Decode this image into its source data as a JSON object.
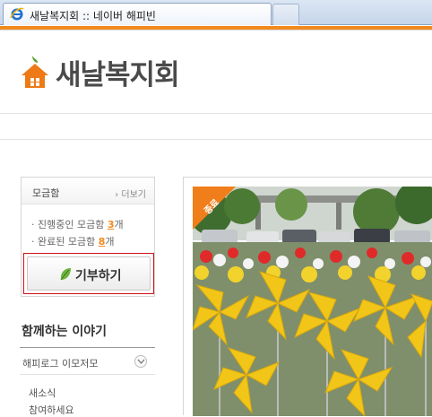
{
  "browser": {
    "tab_title": "새날복지회 :: 네이버 해피빈",
    "tab_icon": "ie-icon"
  },
  "header": {
    "logo_text": "새날복지회",
    "logo_icon": "house-icon",
    "accent_color": "#f08a1c"
  },
  "donation_box": {
    "title": "모금함",
    "more_link": "› 더보기",
    "ongoing_prefix": "· 진행중인 모금함 ",
    "ongoing_count": "3",
    "ongoing_suffix": "개",
    "completed_prefix": "· 완료된 모금함 ",
    "completed_count": "8",
    "completed_suffix": "개",
    "donate_button_label": "기부하기",
    "button_highlight_color": "#d1101b"
  },
  "together": {
    "title": "함께하는 이야기",
    "happylog_label": "해피로그 이모저모",
    "items": [
      "새소식",
      "참여하세요"
    ]
  },
  "photo": {
    "badge_text": "종료",
    "badge_color": "#f07e1a"
  }
}
